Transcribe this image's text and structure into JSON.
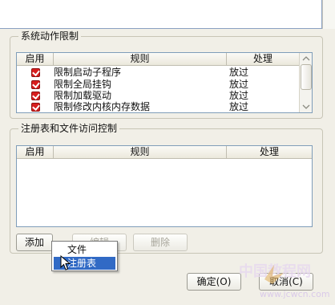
{
  "system_section": {
    "title": "系统动作限制",
    "columns": [
      "启用",
      "规则",
      "处理"
    ],
    "rows": [
      {
        "enabled": true,
        "rule": "限制启动子程序",
        "action": "放过"
      },
      {
        "enabled": true,
        "rule": "限制全局挂钩",
        "action": "放过"
      },
      {
        "enabled": true,
        "rule": "限制加载驱动",
        "action": "放过"
      },
      {
        "enabled": true,
        "rule": "限制修改内核内存数据",
        "action": "放过"
      }
    ]
  },
  "registry_section": {
    "title": "注册表和文件访问控制",
    "columns": [
      "启用",
      "规则",
      "处理"
    ]
  },
  "buttons": {
    "add": "添加",
    "edit": "编辑",
    "delete": "删除",
    "ok": "确定(O)",
    "cancel": "取消(C)"
  },
  "add_menu": {
    "items": [
      "文件",
      "注册表"
    ],
    "highlighted_index": 1
  },
  "watermark": {
    "text_cn": "中国教程网",
    "url": "www.jcwcn.com"
  }
}
